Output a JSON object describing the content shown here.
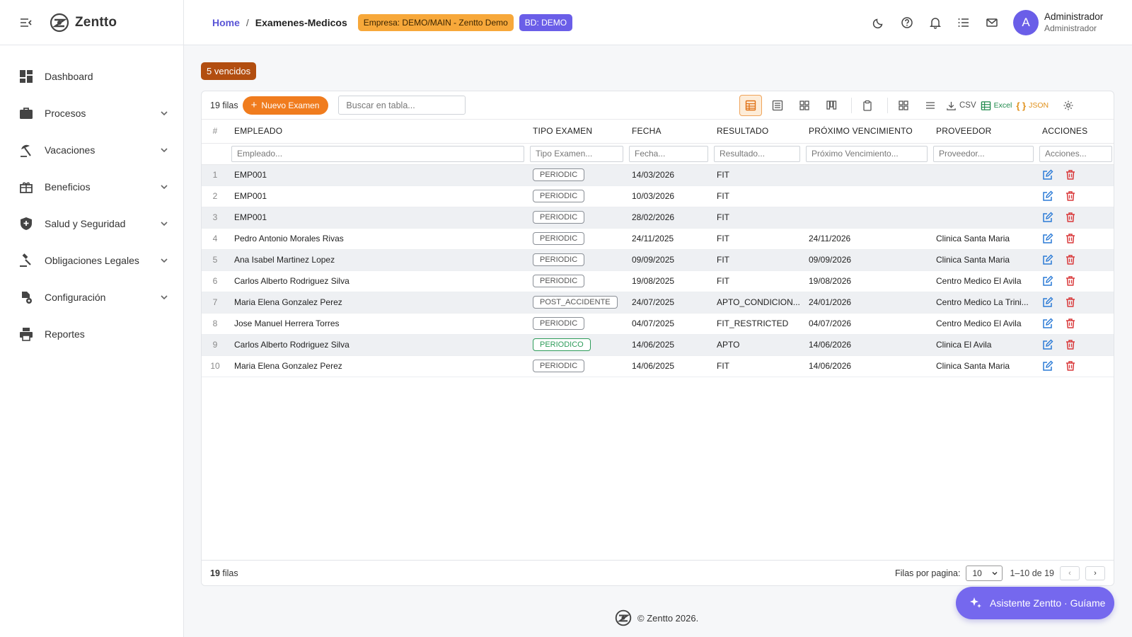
{
  "app": {
    "brand": "Zentto",
    "accent": "#6a5ee8",
    "orange": "#f07c1e"
  },
  "sidebar": {
    "items": [
      {
        "label": "Dashboard",
        "icon": "dashboard-icon",
        "expandable": false
      },
      {
        "label": "Procesos",
        "icon": "briefcase-icon",
        "expandable": true
      },
      {
        "label": "Vacaciones",
        "icon": "beach-icon",
        "expandable": true
      },
      {
        "label": "Beneficios",
        "icon": "gift-icon",
        "expandable": true
      },
      {
        "label": "Salud y Seguridad",
        "icon": "shield-plus-icon",
        "expandable": true
      },
      {
        "label": "Obligaciones Legales",
        "icon": "gavel-icon",
        "expandable": true
      },
      {
        "label": "Configuración",
        "icon": "settings-icon",
        "expandable": true
      },
      {
        "label": "Reportes",
        "icon": "printer-icon",
        "expandable": false
      }
    ]
  },
  "header": {
    "home": "Home",
    "separator": "/",
    "current": "Examenes-Medicos",
    "empresa": "Empresa: DEMO/MAIN - Zentto Demo",
    "bd": "BD: DEMO",
    "icons": [
      "moon-icon",
      "help-icon",
      "bell-icon",
      "list-icon",
      "mail-icon"
    ],
    "user": {
      "initial": "A",
      "name": "Administrador",
      "role": "Administrador"
    }
  },
  "badge": "5 vencidos",
  "toolbar": {
    "rows_label": "19 filas",
    "new_button": "Nuevo Examen",
    "search_placeholder": "Buscar en tabla...",
    "csv": "CSV",
    "excel": "Excel",
    "json": "JSON"
  },
  "table": {
    "columns": {
      "idx": "#",
      "empleado": "EMPLEADO",
      "tipo": "TIPO EXAMEN",
      "fecha": "FECHA",
      "resultado": "RESULTADO",
      "vencimiento": "PRÓXIMO VENCIMIENTO",
      "proveedor": "PROVEEDOR",
      "acciones": "ACCIONES"
    },
    "filters": {
      "empleado": "Empleado...",
      "tipo": "Tipo Examen...",
      "fecha": "Fecha...",
      "resultado": "Resultado...",
      "vencimiento": "Próximo Vencimiento...",
      "proveedor": "Proveedor...",
      "acciones": "Acciones..."
    },
    "rows": [
      {
        "idx": "1",
        "empleado": "EMP001",
        "tipo": "PERIODIC",
        "fecha": "14/03/2026",
        "resultado": "FIT",
        "vencimiento": "",
        "proveedor": ""
      },
      {
        "idx": "2",
        "empleado": "EMP001",
        "tipo": "PERIODIC",
        "fecha": "10/03/2026",
        "resultado": "FIT",
        "vencimiento": "",
        "proveedor": ""
      },
      {
        "idx": "3",
        "empleado": "EMP001",
        "tipo": "PERIODIC",
        "fecha": "28/02/2026",
        "resultado": "FIT",
        "vencimiento": "",
        "proveedor": ""
      },
      {
        "idx": "4",
        "empleado": "Pedro Antonio Morales Rivas",
        "tipo": "PERIODIC",
        "fecha": "24/11/2025",
        "resultado": "FIT",
        "vencimiento": "24/11/2026",
        "proveedor": "Clinica Santa Maria"
      },
      {
        "idx": "5",
        "empleado": "Ana Isabel Martinez Lopez",
        "tipo": "PERIODIC",
        "fecha": "09/09/2025",
        "resultado": "FIT",
        "vencimiento": "09/09/2026",
        "proveedor": "Clinica Santa Maria"
      },
      {
        "idx": "6",
        "empleado": "Carlos Alberto Rodriguez Silva",
        "tipo": "PERIODIC",
        "fecha": "19/08/2025",
        "resultado": "FIT",
        "vencimiento": "19/08/2026",
        "proveedor": "Centro Medico El Avila"
      },
      {
        "idx": "7",
        "empleado": "Maria Elena Gonzalez Perez",
        "tipo": "POST_ACCIDENTE",
        "fecha": "24/07/2025",
        "resultado": "APTO_CONDICION...",
        "vencimiento": "24/01/2026",
        "proveedor": "Centro Medico La Trini..."
      },
      {
        "idx": "8",
        "empleado": "Jose Manuel Herrera Torres",
        "tipo": "PERIODIC",
        "fecha": "04/07/2025",
        "resultado": "FIT_RESTRICTED",
        "vencimiento": "04/07/2026",
        "proveedor": "Centro Medico El Avila"
      },
      {
        "idx": "9",
        "empleado": "Carlos Alberto Rodriguez Silva",
        "tipo": "PERIODICO",
        "fecha": "14/06/2025",
        "resultado": "APTO",
        "vencimiento": "14/06/2026",
        "proveedor": "Clinica El Avila"
      },
      {
        "idx": "10",
        "empleado": "Maria Elena Gonzalez Perez",
        "tipo": "PERIODIC",
        "fecha": "14/06/2025",
        "resultado": "FIT",
        "vencimiento": "14/06/2026",
        "proveedor": "Clinica Santa Maria"
      }
    ]
  },
  "footer": {
    "count_num": "19",
    "count_label": "filas",
    "per_page_label": "Filas por pagina:",
    "per_page_value": "10",
    "range": "1–10 de 19",
    "prev": "‹",
    "next": "›"
  },
  "copyright": "© Zentto 2026.",
  "assistant": "Asistente Zentto · Guíame"
}
